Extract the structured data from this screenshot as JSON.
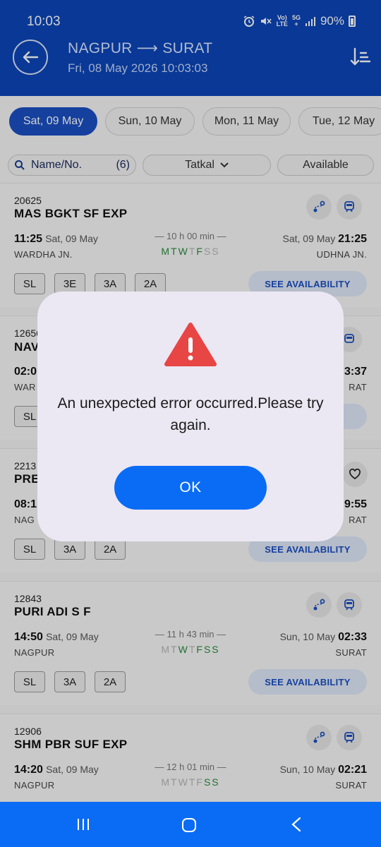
{
  "status": {
    "time": "10:03",
    "net_top": "Vo)",
    "net_bottom": "LTE",
    "gen_top": "5G",
    "gen_bottom": "+",
    "battery": "90%"
  },
  "header": {
    "route": "NAGPUR ⟶ SURAT",
    "datetime": "Fri, 08 May 2026 10:03:03"
  },
  "dates": [
    "Sat, 09 May",
    "Sun, 10 May",
    "Mon, 11 May",
    "Tue, 12 May"
  ],
  "filters": {
    "search_placeholder": "Name/No.",
    "count": "(6)",
    "quota": "Tatkal",
    "availability": "Available"
  },
  "see_availability": "SEE AVAILABILITY",
  "trains": [
    {
      "no": "20625",
      "name": "MAS BGKT SF EXP",
      "dep_time": "11:25",
      "dep_date": "Sat, 09 May",
      "duration": "— 10 h 00 min —",
      "arr_date": "Sat, 09 May",
      "arr_time": "21:25",
      "from": "WARDHA JN.",
      "to": "UDHNA JN.",
      "classes": [
        "SL",
        "3E",
        "3A",
        "2A"
      ]
    },
    {
      "no": "12656",
      "name": "NAV",
      "dep_time": "02:0",
      "arr_time": "3:37",
      "from": "WAR",
      "to": "RAT",
      "classes": [
        "SL"
      ]
    },
    {
      "no": "2213",
      "name": "PRE",
      "dep_time": "08:1",
      "arr_time": "9:55",
      "from": "NAG",
      "to": "RAT",
      "classes": [
        "SL",
        "3A",
        "2A"
      ]
    },
    {
      "no": "12843",
      "name": "PURI ADI S F",
      "dep_time": "14:50",
      "dep_date": "Sat, 09 May",
      "duration": "— 11 h 43 min —",
      "arr_date": "Sun, 10 May",
      "arr_time": "02:33",
      "from": "NAGPUR",
      "to": "SURAT",
      "classes": [
        "SL",
        "3A",
        "2A"
      ]
    },
    {
      "no": "12906",
      "name": "SHM PBR SUF EXP",
      "dep_time": "14:20",
      "dep_date": "Sat, 09 May",
      "duration": "— 12 h 01 min —",
      "arr_date": "Sun, 10 May",
      "arr_time": "02:21",
      "from": "NAGPUR",
      "to": "SURAT",
      "classes": []
    }
  ],
  "days": {
    "letters": [
      "M",
      "T",
      "W",
      "T",
      "F",
      "S",
      "S"
    ],
    "train1": [
      true,
      true,
      true,
      false,
      true,
      false,
      false
    ],
    "train4": [
      false,
      false,
      true,
      false,
      true,
      true,
      true
    ],
    "train5": [
      false,
      false,
      false,
      false,
      false,
      true,
      true
    ]
  },
  "dialog": {
    "message": "An unexpected error occurred.Please try again.",
    "ok_label": "OK"
  },
  "colors": {
    "primary": "#0b45b8",
    "button": "#0a6cf5",
    "error": "#e84545",
    "available_day": "#2a8a3c"
  }
}
